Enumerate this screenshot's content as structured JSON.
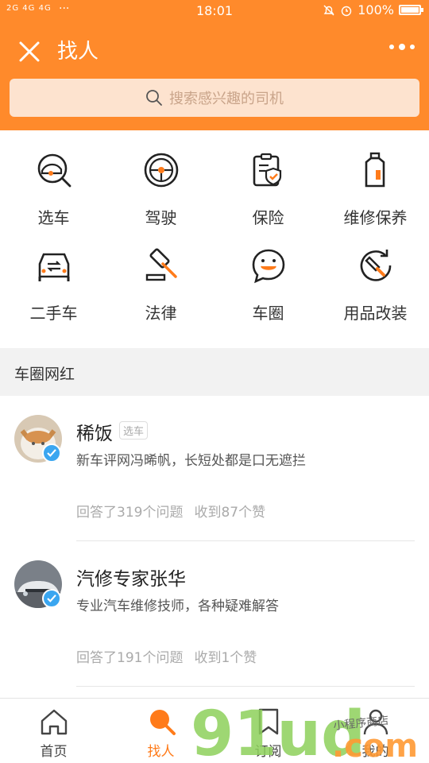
{
  "status_bar": {
    "network": "2G 4G 4G",
    "dots": "···",
    "time": "18:01",
    "battery": "100%",
    "battery_level": 1.0
  },
  "header": {
    "title": "找人"
  },
  "search": {
    "placeholder": "搜索感兴趣的司机"
  },
  "categories": [
    {
      "label": "选车",
      "icon": "car-search-icon"
    },
    {
      "label": "驾驶",
      "icon": "steering-wheel-icon"
    },
    {
      "label": "保险",
      "icon": "insurance-shield-icon"
    },
    {
      "label": "维修保养",
      "icon": "oil-can-icon"
    },
    {
      "label": "二手车",
      "icon": "used-car-icon"
    },
    {
      "label": "法律",
      "icon": "gavel-icon"
    },
    {
      "label": "车圈",
      "icon": "chat-bubble-icon"
    },
    {
      "label": "用品改装",
      "icon": "wrench-cycle-icon"
    }
  ],
  "section": {
    "title": "车圈网红"
  },
  "drivers": [
    {
      "name": "稀饭",
      "tag": "选车",
      "desc": "新车评网冯晞帆，长短处都是口无遮拦",
      "answers": "回答了319个问题",
      "likes": "收到87个赞",
      "verified": true
    },
    {
      "name": "汽修专家张华",
      "tag": "",
      "desc": "专业汽车维修技师，各种疑难解答",
      "answers": "回答了191个问题",
      "likes": "收到1个赞",
      "verified": true
    }
  ],
  "tabs": [
    {
      "label": "首页",
      "icon": "home-icon",
      "active": false
    },
    {
      "label": "找人",
      "icon": "search-person-icon",
      "active": true
    },
    {
      "label": "订阅",
      "icon": "bookmark-icon",
      "active": false
    },
    {
      "label": "我的",
      "icon": "profile-icon",
      "active": false
    }
  ],
  "watermark": {
    "text": "91ud.com",
    "subtext": "小程序商店"
  },
  "colors": {
    "brand": "#ff8a2b",
    "search_bg": "#fde3cf",
    "active_tab": "#ff7b1a",
    "verify": "#3aa6f0",
    "section_bg": "#f2f2f2"
  }
}
